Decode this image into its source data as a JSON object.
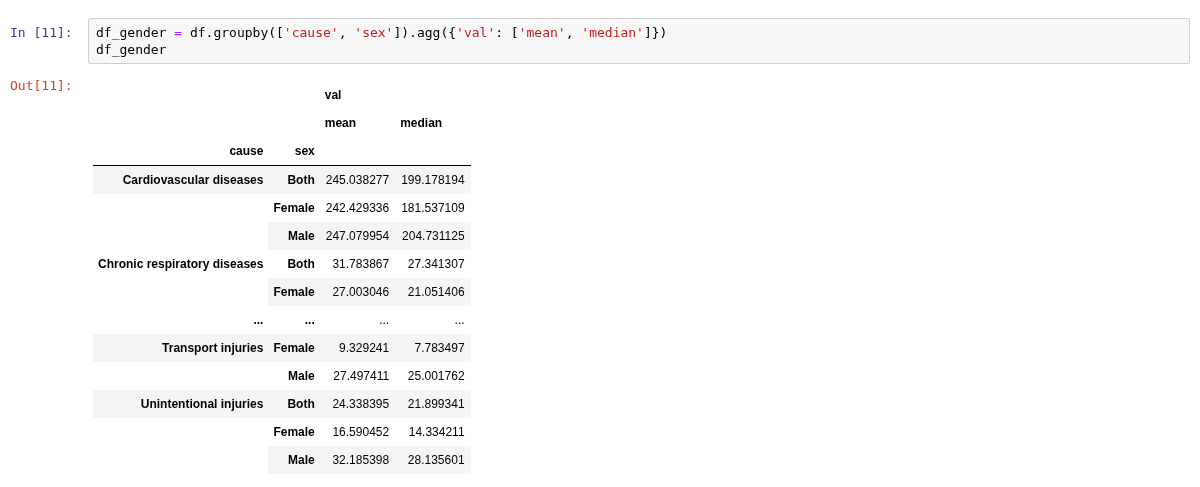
{
  "input_prompt": "In [11]:",
  "code_lines": [
    [
      {
        "kind": "name",
        "text": "df_gender "
      },
      {
        "kind": "operator",
        "text": "="
      },
      {
        "kind": "name",
        "text": " df.groupby(["
      },
      {
        "kind": "string",
        "text": "'cause'"
      },
      {
        "kind": "name",
        "text": ", "
      },
      {
        "kind": "string",
        "text": "'sex'"
      },
      {
        "kind": "name",
        "text": "]).agg({"
      },
      {
        "kind": "string",
        "text": "'val'"
      },
      {
        "kind": "name",
        "text": ": ["
      },
      {
        "kind": "string",
        "text": "'mean'"
      },
      {
        "kind": "name",
        "text": ", "
      },
      {
        "kind": "string",
        "text": "'median'"
      },
      {
        "kind": "name",
        "text": "]})"
      }
    ],
    [
      {
        "kind": "name",
        "text": "df_gender"
      }
    ]
  ],
  "output_prompt": "Out[11]:",
  "table": {
    "column_group": "val",
    "columns": [
      "mean",
      "median"
    ],
    "index_names": [
      "cause",
      "sex"
    ],
    "rows": [
      {
        "cause": "Cardiovascular diseases",
        "sex": "Both",
        "mean": "245.038277",
        "median": "199.178194"
      },
      {
        "cause": null,
        "sex": "Female",
        "mean": "242.429336",
        "median": "181.537109"
      },
      {
        "cause": null,
        "sex": "Male",
        "mean": "247.079954",
        "median": "204.731125"
      },
      {
        "cause": "Chronic respiratory diseases",
        "sex": "Both",
        "mean": "31.783867",
        "median": "27.341307"
      },
      {
        "cause": null,
        "sex": "Female",
        "mean": "27.003046",
        "median": "21.051406"
      },
      {
        "cause": "...",
        "sex": "...",
        "mean": "...",
        "median": "..."
      },
      {
        "cause": "Transport injuries",
        "sex": "Female",
        "mean": "9.329241",
        "median": "7.783497"
      },
      {
        "cause": null,
        "sex": "Male",
        "mean": "27.497411",
        "median": "25.001762"
      },
      {
        "cause": "Unintentional injuries",
        "sex": "Both",
        "mean": "24.338395",
        "median": "21.899341"
      },
      {
        "cause": null,
        "sex": "Female",
        "mean": "16.590452",
        "median": "14.334211"
      },
      {
        "cause": null,
        "sex": "Male",
        "mean": "32.185398",
        "median": "28.135601"
      }
    ]
  }
}
